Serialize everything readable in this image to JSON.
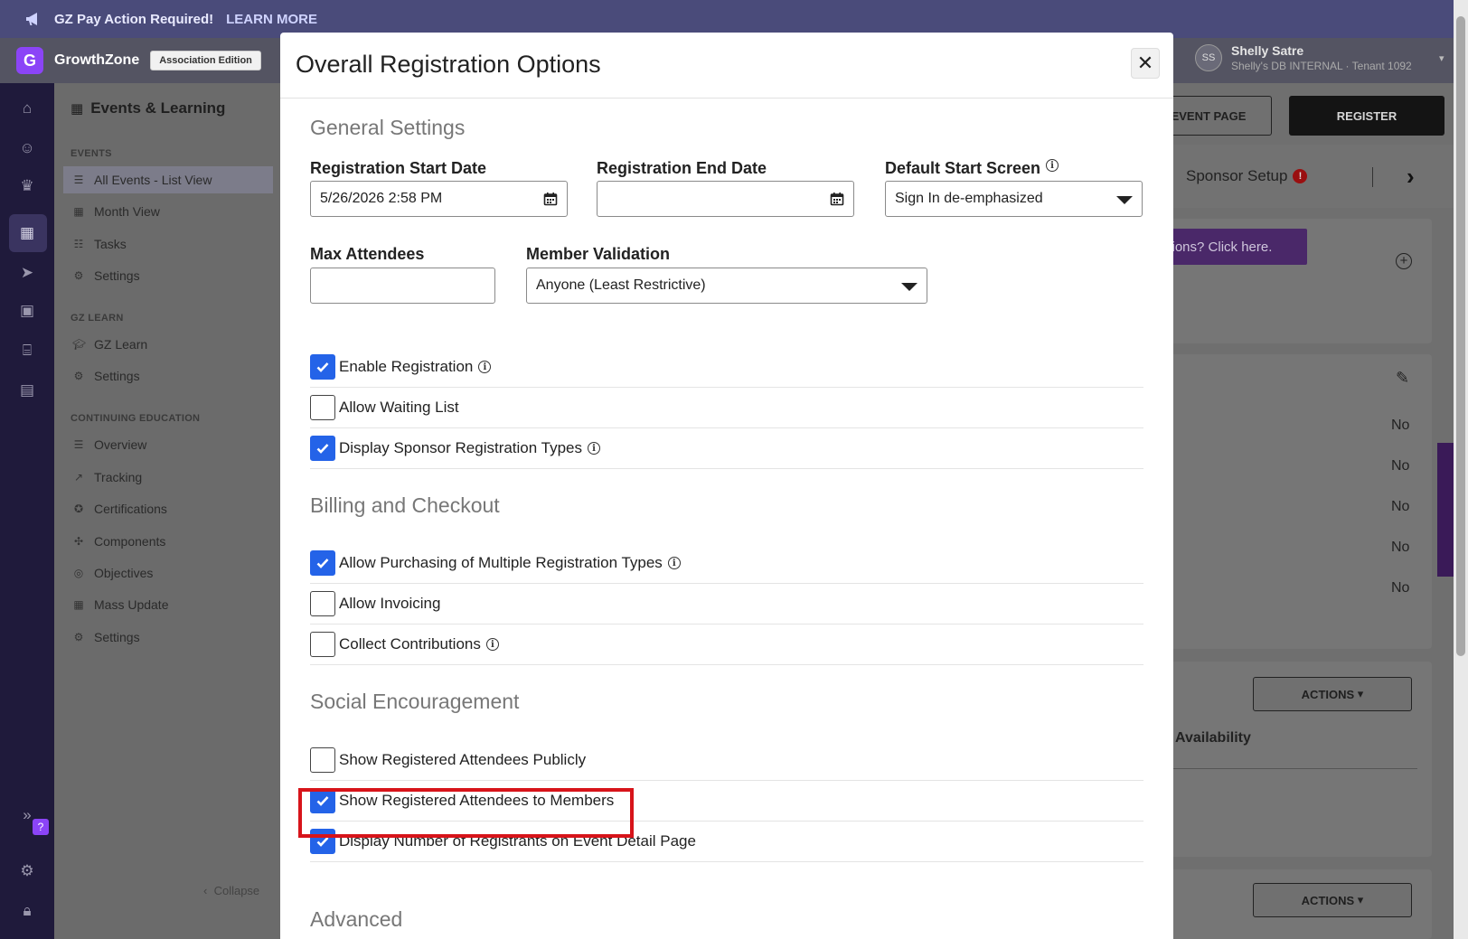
{
  "banner": {
    "text": "GZ Pay Action Required!",
    "link": "LEARN MORE"
  },
  "topbar": {
    "brand": "GrowthZone",
    "edition": "Association Edition",
    "user": {
      "initials": "SS",
      "name": "Shelly Satre",
      "org": "Shelly's DB INTERNAL · Tenant 1092"
    }
  },
  "sidenav": {
    "title": "Events & Learning",
    "sections": [
      {
        "label": "EVENTS",
        "items": [
          "All Events - List View",
          "Month View",
          "Tasks",
          "Settings"
        ]
      },
      {
        "label": "GZ LEARN",
        "items": [
          "GZ Learn",
          "Settings"
        ]
      },
      {
        "label": "CONTINUING EDUCATION",
        "items": [
          "Overview",
          "Tracking",
          "Certifications",
          "Components",
          "Objectives",
          "Mass Update",
          "Settings"
        ]
      }
    ],
    "collapse": "Collapse"
  },
  "background": {
    "event_page_btn": "EVENT PAGE",
    "register_btn": "REGISTER",
    "sponsor_tab": "Sponsor Setup",
    "questions_pill": "ations? Click here.",
    "no_values": [
      "No",
      "No",
      "No",
      "No",
      "No"
    ],
    "actions_btn": "ACTIONS",
    "availability": "Availability"
  },
  "modal": {
    "title": "Overall Registration Options",
    "sections": {
      "general": "General Settings",
      "billing": "Billing and Checkout",
      "social": "Social Encouragement",
      "advanced": "Advanced"
    },
    "fields": {
      "start_date_label": "Registration Start Date",
      "start_date_value": "5/26/2026 2:58 PM",
      "end_date_label": "Registration End Date",
      "end_date_value": "",
      "default_screen_label": "Default Start Screen",
      "default_screen_value": "Sign In de-emphasized",
      "max_attendees_label": "Max Attendees",
      "max_attendees_value": "",
      "member_validation_label": "Member Validation",
      "member_validation_value": "Anyone (Least Restrictive)"
    },
    "checks": {
      "enable_registration": {
        "label": "Enable Registration",
        "checked": true
      },
      "allow_waiting_list": {
        "label": "Allow Waiting List",
        "checked": false
      },
      "display_sponsor_types": {
        "label": "Display Sponsor Registration Types",
        "checked": true
      },
      "allow_multiple_types": {
        "label": "Allow Purchasing of Multiple Registration Types",
        "checked": true
      },
      "allow_invoicing": {
        "label": "Allow Invoicing",
        "checked": false
      },
      "collect_contributions": {
        "label": "Collect Contributions",
        "checked": false
      },
      "show_publicly": {
        "label": "Show Registered Attendees Publicly",
        "checked": false
      },
      "show_members": {
        "label": "Show Registered Attendees to Members",
        "checked": true
      },
      "display_number": {
        "label": "Display Number of Registrants on Event Detail Page",
        "checked": true
      }
    }
  },
  "colors": {
    "primary_check": "#2463e8",
    "highlight": "#d7141a",
    "brand_purple": "#8b44f7"
  }
}
